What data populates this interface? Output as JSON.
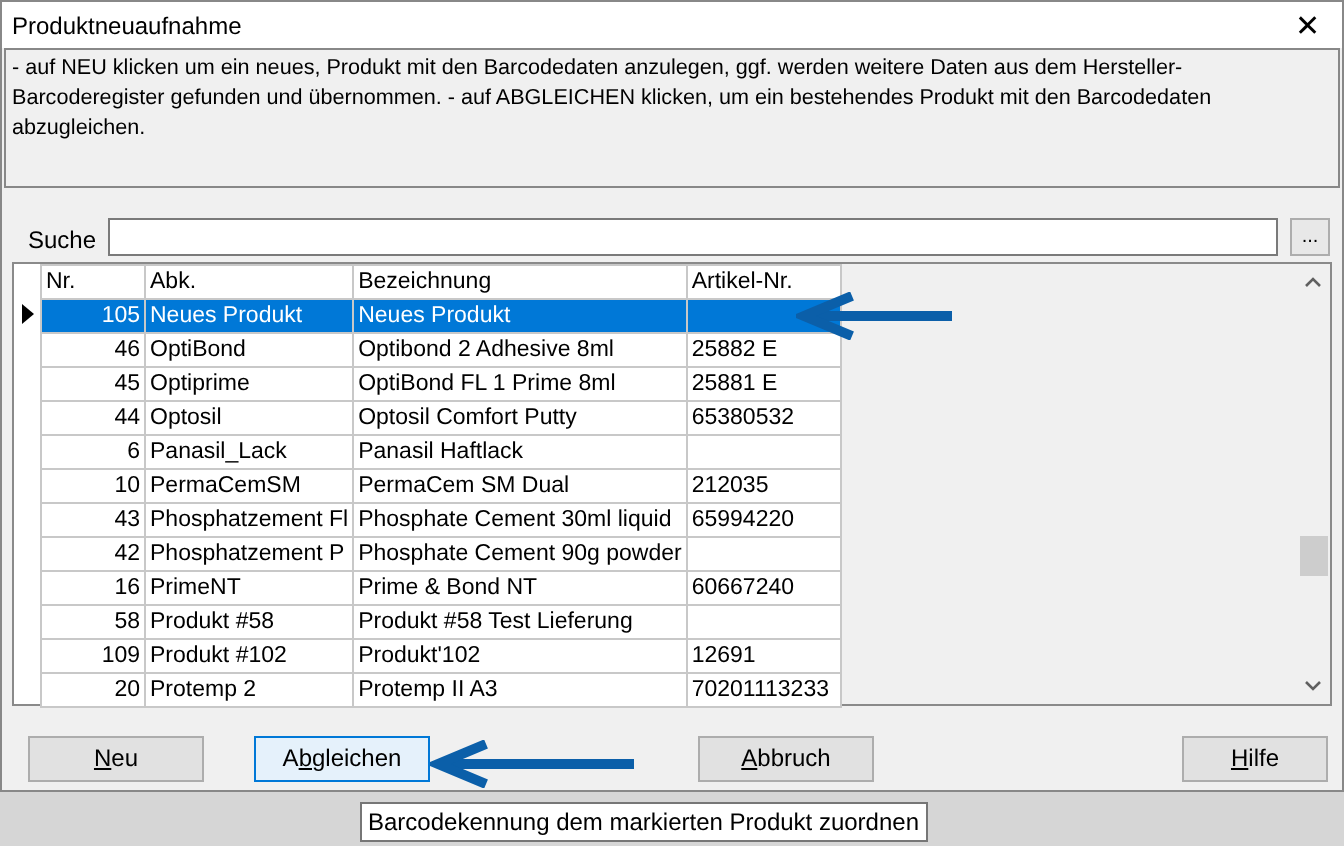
{
  "window": {
    "title": "Produktneuaufnahme",
    "close": "✕"
  },
  "info_text": "- auf NEU klicken um ein neues, Produkt mit den Barcodedaten anzulegen, ggf. werden weitere Daten aus dem Hersteller-Barcoderegister gefunden und übernommen. - auf ABGLEICHEN klicken, um ein bestehendes Produkt mit den Barcodedaten abzugleichen.",
  "search": {
    "label": "Suche",
    "browse": "..."
  },
  "table": {
    "columns": [
      "Nr.",
      "Abk.",
      "Bezeichnung",
      "Artikel-Nr."
    ],
    "rows": [
      {
        "cells": [
          "105",
          "Neues Produkt",
          "Neues Produkt",
          ""
        ],
        "selected": true
      },
      {
        "cells": [
          "46",
          "OptiBond",
          "Optibond 2 Adhesive 8ml",
          "25882 E"
        ],
        "selected": false
      },
      {
        "cells": [
          "45",
          "Optiprime",
          "OptiBond FL  1 Prime 8ml",
          "25881 E"
        ],
        "selected": false
      },
      {
        "cells": [
          "44",
          "Optosil",
          "Optosil Comfort Putty",
          "65380532"
        ],
        "selected": false
      },
      {
        "cells": [
          "6",
          "Panasil_Lack",
          "Panasil Haftlack",
          ""
        ],
        "selected": false
      },
      {
        "cells": [
          "10",
          "PermaCemSM",
          "PermaCem SM Dual",
          "212035"
        ],
        "selected": false
      },
      {
        "cells": [
          "43",
          "Phosphatzement Fl",
          "Phosphate Cement  30ml liquid",
          "65994220"
        ],
        "selected": false
      },
      {
        "cells": [
          "42",
          "Phosphatzement P",
          "Phosphate Cement 90g powder",
          ""
        ],
        "selected": false
      },
      {
        "cells": [
          "16",
          "PrimeNT",
          "Prime & Bond NT",
          "60667240"
        ],
        "selected": false
      },
      {
        "cells": [
          "58",
          "Produkt #58",
          "Produkt #58 Test Lieferung",
          ""
        ],
        "selected": false
      },
      {
        "cells": [
          "109",
          "Produkt #102",
          "Produkt'102",
          "12691"
        ],
        "selected": false
      },
      {
        "cells": [
          "20",
          "Protemp 2",
          "Protemp II A3",
          "70201113233"
        ],
        "selected": false
      }
    ]
  },
  "buttons": [
    {
      "key": "N",
      "after": "eu",
      "focused": false
    },
    {
      "before": "A",
      "key": "b",
      "after": "gleichen",
      "focused": true
    },
    {
      "key": "A",
      "after": "bbruch",
      "focused": false
    },
    {
      "key": "H",
      "after": "ilfe",
      "focused": false
    }
  ],
  "tooltip": "Barcodekennung dem markierten Produkt zuordnen"
}
